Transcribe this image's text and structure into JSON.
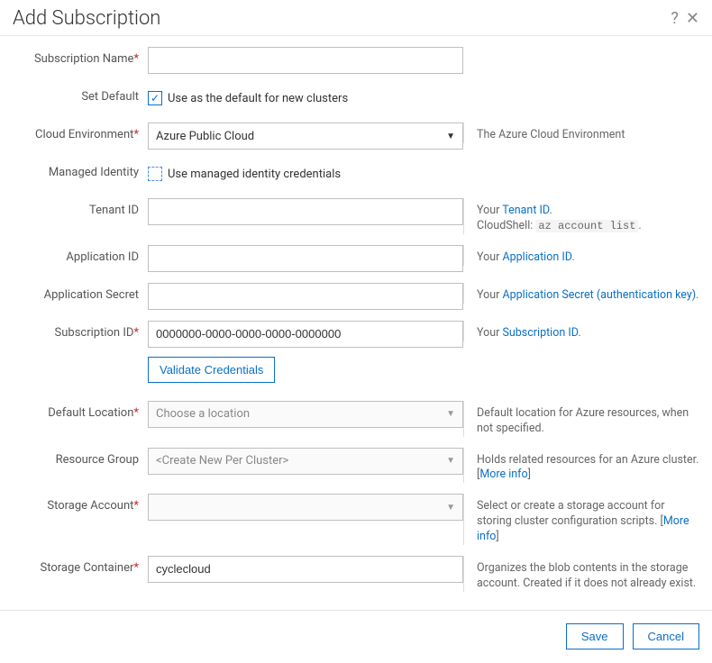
{
  "dialog": {
    "title": "Add Subscription",
    "save_label": "Save",
    "cancel_label": "Cancel"
  },
  "fields": {
    "subscription_name": {
      "label": "Subscription Name",
      "value": ""
    },
    "set_default": {
      "label": "Set Default",
      "checkbox_label": "Use as the default for new clusters",
      "checked": true
    },
    "cloud_environment": {
      "label": "Cloud Environment",
      "value": "Azure Public Cloud",
      "help": "The Azure Cloud Environment"
    },
    "managed_identity": {
      "label": "Managed Identity",
      "checkbox_label": "Use managed identity credentials",
      "checked": false
    },
    "tenant_id": {
      "label": "Tenant ID",
      "value": "",
      "help_prefix": "Your ",
      "help_link": "Tenant ID",
      "help_suffix": ".",
      "help_line2_prefix": "CloudShell: ",
      "help_line2_code": "az account list",
      "help_line2_suffix": "."
    },
    "application_id": {
      "label": "Application ID",
      "value": "",
      "help_prefix": "Your ",
      "help_link": "Application ID",
      "help_suffix": "."
    },
    "application_secret": {
      "label": "Application Secret",
      "value": "",
      "help_prefix": "Your ",
      "help_link": "Application Secret (authentication key)",
      "help_suffix": "."
    },
    "subscription_id": {
      "label": "Subscription ID",
      "value": "0000000-0000-0000-0000-0000000",
      "help_prefix": "Your ",
      "help_link": "Subscription ID",
      "help_suffix": "."
    },
    "validate_button": "Validate Credentials",
    "default_location": {
      "label": "Default Location",
      "placeholder": "Choose a location",
      "help": "Default location for Azure resources, when not specified."
    },
    "resource_group": {
      "label": "Resource Group",
      "placeholder": "<Create New Per Cluster>",
      "help_prefix": "Holds related resources for an Azure cluster. [",
      "help_link": "More info",
      "help_suffix": "]"
    },
    "storage_account": {
      "label": "Storage Account",
      "placeholder": "",
      "help_prefix": "Select or create a storage account for storing cluster configuration scripts. [",
      "help_link": "More info",
      "help_suffix": "]"
    },
    "storage_container": {
      "label": "Storage Container",
      "value": "cyclecloud",
      "help": "Organizes the blob contents in the storage account. Created if it does not already exist."
    }
  }
}
